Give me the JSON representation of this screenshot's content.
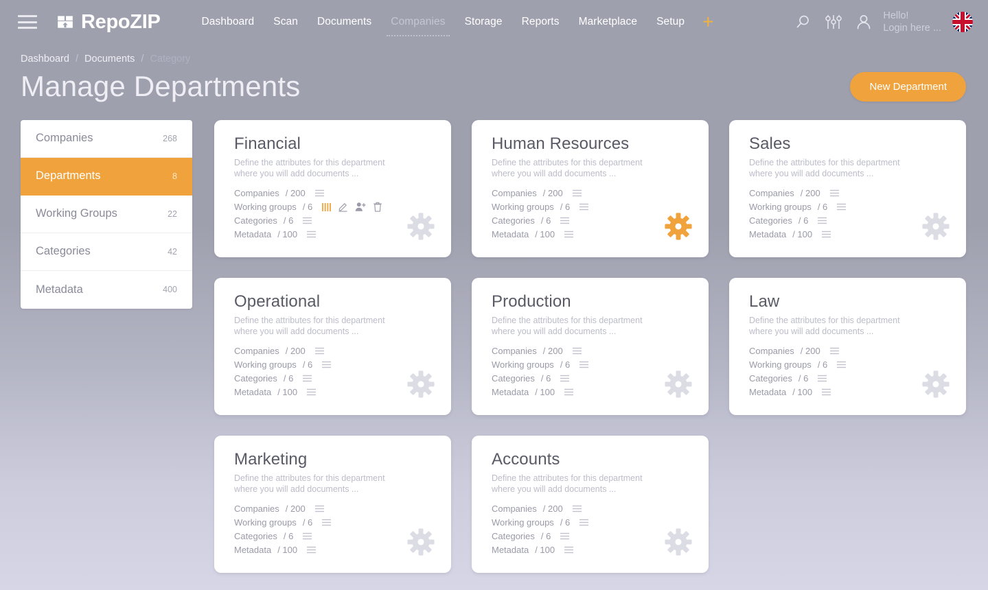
{
  "header": {
    "menu_icon": "hamburger-menu-icon",
    "logo_icon": "repozip-box-icon",
    "brand": "RepoZIP",
    "nav": [
      {
        "label": "Dashboard",
        "active": false
      },
      {
        "label": "Scan",
        "active": false
      },
      {
        "label": "Documents",
        "active": false
      },
      {
        "label": "Companies",
        "active": true
      },
      {
        "label": "Storage",
        "active": false
      },
      {
        "label": "Reports",
        "active": false
      },
      {
        "label": "Marketplace",
        "active": false
      },
      {
        "label": "Setup",
        "active": false
      }
    ],
    "add_label": "+",
    "search_icon": "search-icon",
    "settings_icon": "sliders-icon",
    "user_icon": "user-avatar-icon",
    "greeting_line1": "Hello!",
    "greeting_line2": "Login here ...",
    "flag_icon": "uk-flag-icon"
  },
  "breadcrumb": {
    "items": [
      "Dashboard",
      "Documents",
      "Category"
    ],
    "separator": "/"
  },
  "page": {
    "title": "Manage Departments",
    "primary_action": "New Department"
  },
  "sidebar": {
    "items": [
      {
        "label": "Companies",
        "count": "268",
        "active": false
      },
      {
        "label": "Departments",
        "count": "8",
        "active": true
      },
      {
        "label": "Working Groups",
        "count": "22",
        "active": false
      },
      {
        "label": "Categories",
        "count": "42",
        "active": false
      },
      {
        "label": "Metadata",
        "count": "400",
        "active": false
      }
    ]
  },
  "colors": {
    "accent": "#f0a33c",
    "accent_plus": "#f2b33d",
    "card_bg": "#ffffff",
    "page_bg_top": "#9fa0ae",
    "page_bg_bottom": "#d6d6e6",
    "title_text": "#eeeef4",
    "card_title": "#5a5a66",
    "muted_text": "#bcbcc9",
    "gear_idle": "#dcdce5",
    "gear_active": "#f0a33c"
  },
  "cards": [
    {
      "title": "Financial",
      "description": "Define the attributes for this department where you will add documents ...",
      "gear_state": "idle",
      "stats": [
        {
          "name": "Companies",
          "value": "/ 200",
          "actions": [
            "list-icon"
          ]
        },
        {
          "name": "Working groups",
          "value": "/ 6",
          "actions": [
            "bars-icon-active",
            "edit-pencil-icon",
            "add-user-icon",
            "trash-icon"
          ]
        },
        {
          "name": "Categories",
          "value": "/ 6",
          "actions": [
            "list-icon"
          ]
        },
        {
          "name": "Metadata",
          "value": "/ 100",
          "actions": [
            "list-icon"
          ]
        }
      ]
    },
    {
      "title": "Human Resources",
      "description": "Define the attributes for this department where you will add documents ...",
      "gear_state": "active",
      "stats": [
        {
          "name": "Companies",
          "value": "/ 200",
          "actions": [
            "list-icon"
          ]
        },
        {
          "name": "Working groups",
          "value": "/ 6",
          "actions": [
            "list-icon"
          ]
        },
        {
          "name": "Categories",
          "value": "/ 6",
          "actions": [
            "list-icon"
          ]
        },
        {
          "name": "Metadata",
          "value": "/ 100",
          "actions": [
            "list-icon"
          ]
        }
      ]
    },
    {
      "title": "Sales",
      "description": "Define the attributes for this department where you will add documents ...",
      "gear_state": "idle",
      "stats": [
        {
          "name": "Companies",
          "value": "/ 200",
          "actions": [
            "list-icon"
          ]
        },
        {
          "name": "Working groups",
          "value": "/ 6",
          "actions": [
            "list-icon"
          ]
        },
        {
          "name": "Categories",
          "value": "/ 6",
          "actions": [
            "list-icon"
          ]
        },
        {
          "name": "Metadata",
          "value": "/ 100",
          "actions": [
            "list-icon"
          ]
        }
      ]
    },
    {
      "title": "Operational",
      "description": "Define the attributes for this department where you will add documents ...",
      "gear_state": "idle",
      "stats": [
        {
          "name": "Companies",
          "value": "/ 200",
          "actions": [
            "list-icon"
          ]
        },
        {
          "name": "Working groups",
          "value": "/ 6",
          "actions": [
            "list-icon"
          ]
        },
        {
          "name": "Categories",
          "value": "/ 6",
          "actions": [
            "list-icon"
          ]
        },
        {
          "name": "Metadata",
          "value": "/ 100",
          "actions": [
            "list-icon"
          ]
        }
      ]
    },
    {
      "title": "Production",
      "description": "Define the attributes for this department where you will add documents ...",
      "gear_state": "idle",
      "stats": [
        {
          "name": "Companies",
          "value": "/ 200",
          "actions": [
            "list-icon"
          ]
        },
        {
          "name": "Working groups",
          "value": "/ 6",
          "actions": [
            "list-icon"
          ]
        },
        {
          "name": "Categories",
          "value": "/ 6",
          "actions": [
            "list-icon"
          ]
        },
        {
          "name": "Metadata",
          "value": "/ 100",
          "actions": [
            "list-icon"
          ]
        }
      ]
    },
    {
      "title": "Law",
      "description": "Define the attributes for this department where you will add documents ...",
      "gear_state": "idle",
      "stats": [
        {
          "name": "Companies",
          "value": "/ 200",
          "actions": [
            "list-icon"
          ]
        },
        {
          "name": "Working groups",
          "value": "/ 6",
          "actions": [
            "list-icon"
          ]
        },
        {
          "name": "Categories",
          "value": "/ 6",
          "actions": [
            "list-icon"
          ]
        },
        {
          "name": "Metadata",
          "value": "/ 100",
          "actions": [
            "list-icon"
          ]
        }
      ]
    },
    {
      "title": "Marketing",
      "description": "Define the attributes for this department where you will add documents ...",
      "gear_state": "idle",
      "stats": [
        {
          "name": "Companies",
          "value": "/ 200",
          "actions": [
            "list-icon"
          ]
        },
        {
          "name": "Working groups",
          "value": "/ 6",
          "actions": [
            "list-icon"
          ]
        },
        {
          "name": "Categories",
          "value": "/ 6",
          "actions": [
            "list-icon"
          ]
        },
        {
          "name": "Metadata",
          "value": "/ 100",
          "actions": [
            "list-icon"
          ]
        }
      ]
    },
    {
      "title": "Accounts",
      "description": "Define the attributes for this department where you will add documents ...",
      "gear_state": "idle",
      "stats": [
        {
          "name": "Companies",
          "value": "/ 200",
          "actions": [
            "list-icon"
          ]
        },
        {
          "name": "Working groups",
          "value": "/ 6",
          "actions": [
            "list-icon"
          ]
        },
        {
          "name": "Categories",
          "value": "/ 6",
          "actions": [
            "list-icon"
          ]
        },
        {
          "name": "Metadata",
          "value": "/ 100",
          "actions": [
            "list-icon"
          ]
        }
      ]
    }
  ]
}
